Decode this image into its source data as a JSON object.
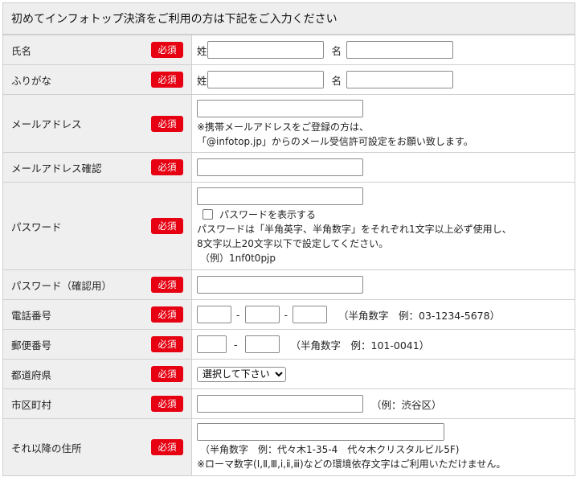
{
  "header": {
    "title": "初めてインフォトップ決済をご利用の方は下記をご入力ください"
  },
  "required_label": "必須",
  "rows": {
    "name": {
      "label": "氏名",
      "sei": "姓",
      "mei": "名"
    },
    "furigana": {
      "label": "ふりがな",
      "sei": "姓",
      "mei": "名"
    },
    "email": {
      "label": "メールアドレス",
      "note1": "※携帯メールアドレスをご登録の方は、",
      "note2": "「@infotop.jp」からのメール受信許可設定をお願い致します。"
    },
    "email_confirm": {
      "label": "メールアドレス確認"
    },
    "password": {
      "label": "パスワード",
      "show_label": "パスワードを表示する",
      "note1": "パスワードは「半角英字、半角数字」をそれぞれ1文字以上必ず使用し、",
      "note2": "8文字以上20文字以下で設定してください。",
      "example": "（例）1nf0t0pjp"
    },
    "password_confirm": {
      "label": "パスワード（確認用）"
    },
    "phone": {
      "label": "電話番号",
      "sep": "-",
      "hint": "（半角数字　例：03-1234-5678）"
    },
    "postal": {
      "label": "郵便番号",
      "sep": "-",
      "hint": "（半角数字　例：101-0041）"
    },
    "prefecture": {
      "label": "都道府県",
      "selected": "選択して下さい"
    },
    "city": {
      "label": "市区町村",
      "hint": "（例：渋谷区）"
    },
    "address": {
      "label": "それ以降の住所",
      "note1": "（半角数字　例：代々木1-35-4　代々木クリスタルビル5F)",
      "note2": "※ローマ数字(Ⅰ,Ⅱ,Ⅲ,ⅰ,ⅱ,ⅲ)などの環境依存文字はご利用いただけません。"
    }
  }
}
